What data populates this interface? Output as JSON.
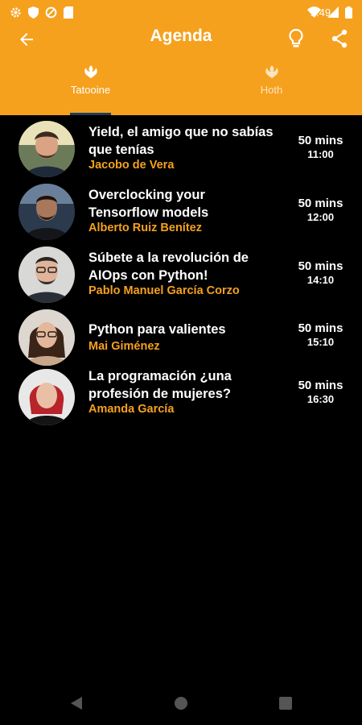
{
  "status_bar": {
    "time": "1:49"
  },
  "app_bar": {
    "title": "Agenda",
    "background": "#F5A11E",
    "icons": {
      "back": "back-arrow-icon",
      "tip": "lightbulb-icon",
      "share": "share-icon"
    }
  },
  "tabs": [
    {
      "label": "Tatooine",
      "selected": true,
      "icon": "rebel-alliance-icon"
    },
    {
      "label": "Hoth",
      "selected": false,
      "icon": "rebel-alliance-icon"
    }
  ],
  "talks": [
    {
      "title_lines": [
        "Yield, el amigo que no sabías",
        "que tenías"
      ],
      "speaker": "Jacobo de Vera",
      "duration": "50 mins",
      "time": "11:00"
    },
    {
      "title_lines": [
        "Overclocking your",
        "Tensorflow models"
      ],
      "speaker": "Alberto Ruiz Benítez",
      "duration": "50 mins",
      "time": "12:00"
    },
    {
      "title_lines": [
        "Súbete a la revolución de",
        "AIOps con Python!"
      ],
      "speaker": "Pablo Manuel García Corzo",
      "duration": "50 mins",
      "time": "14:10"
    },
    {
      "title_lines": [
        "Python para valientes"
      ],
      "speaker": "Mai Giménez",
      "duration": "50 mins",
      "time": "15:10"
    },
    {
      "title_lines": [
        "La programación ¿una",
        "profesión de mujeres?"
      ],
      "speaker": "Amanda García",
      "duration": "50 mins",
      "time": "16:30"
    }
  ],
  "colors": {
    "accent": "#F5A11E",
    "background": "#000000",
    "tab_indicator": "#1f3b5a"
  }
}
